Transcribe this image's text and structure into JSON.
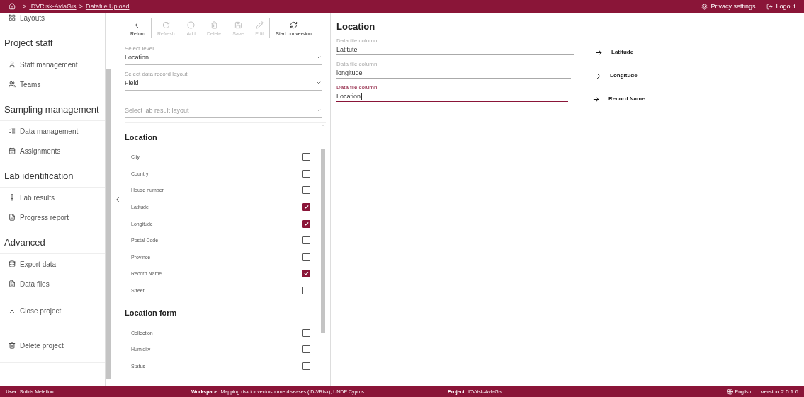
{
  "top_bar": {
    "breadcrumb": [
      {
        "label": ">",
        "link": false
      },
      {
        "label": "IDVRisk-AvlaGis",
        "link": true
      },
      {
        "label": ">",
        "link": false
      },
      {
        "label": "Datafile Upload",
        "link": true
      }
    ],
    "actions": [
      {
        "label": "Privacy settings"
      },
      {
        "label": "Logout"
      }
    ]
  },
  "sidebar": {
    "sections": [
      {
        "items": [
          {
            "label": "Layouts"
          }
        ]
      },
      {
        "title": "Project staff",
        "items": [
          {
            "label": "Staff management"
          },
          {
            "label": "Teams"
          }
        ]
      },
      {
        "title": "Sampling management",
        "items": [
          {
            "label": "Data management"
          },
          {
            "label": "Assignments"
          }
        ]
      },
      {
        "title": "Lab identification",
        "items": [
          {
            "label": "Lab results"
          },
          {
            "label": "Progress report"
          }
        ]
      },
      {
        "title": "Advanced",
        "items": [
          {
            "label": "Export data"
          },
          {
            "label": "Data files"
          }
        ]
      },
      {
        "items": [
          {
            "label": "Close project"
          }
        ]
      },
      {
        "items": [
          {
            "label": "Delete project"
          }
        ]
      }
    ]
  },
  "toolbar": [
    {
      "label": "Return",
      "disabled": false
    },
    {
      "label": "Refresh",
      "disabled": true
    },
    {
      "label": "Add",
      "disabled": true
    },
    {
      "label": "Delete",
      "disabled": true
    },
    {
      "label": "Save",
      "disabled": true
    },
    {
      "label": "Edit",
      "disabled": true
    },
    {
      "label": "Start conversion",
      "disabled": false
    }
  ],
  "selects": [
    {
      "label": "Select level",
      "value": "Location"
    },
    {
      "label": "Select data record layout",
      "value": "Field"
    },
    {
      "placeholder": "Select lab result layout"
    }
  ],
  "field_groups": [
    {
      "title": "Location",
      "fields": [
        {
          "label": "City",
          "checked": false
        },
        {
          "label": "Country",
          "checked": false
        },
        {
          "label": "House number",
          "checked": false
        },
        {
          "label": "Latitude",
          "checked": true
        },
        {
          "label": "Longitude",
          "checked": true
        },
        {
          "label": "Postal Code",
          "checked": false
        },
        {
          "label": "Province",
          "checked": false
        },
        {
          "label": "Record Name",
          "checked": true
        },
        {
          "label": "Street",
          "checked": false
        }
      ]
    },
    {
      "title": "Location form",
      "fields": [
        {
          "label": "Collection",
          "checked": false
        },
        {
          "label": "Humidity",
          "checked": false
        },
        {
          "label": "Status",
          "checked": false
        }
      ]
    }
  ],
  "mapping": {
    "title": "Location",
    "rows": [
      {
        "label": "Data file column",
        "value": "Latitute",
        "focused": false,
        "target": "Latitude"
      },
      {
        "label": "Data file column",
        "value": "longitude",
        "focused": false,
        "target": "Longitude"
      },
      {
        "label": "Data file column",
        "value": "Location",
        "focused": true,
        "target": "Record Name"
      }
    ]
  },
  "status_bar": {
    "user": {
      "label": "User:",
      "value": "Sotiris Meletiou"
    },
    "workspace": {
      "label": "Workspace:",
      "value": "Mapping risk for vector-borne diseases (ID-VRisk), UNDP Cyprus"
    },
    "project": {
      "label": "Project:",
      "value": "IDVrisk-AvlaGis"
    },
    "language": "English",
    "version": "version 2.5.1.6"
  }
}
